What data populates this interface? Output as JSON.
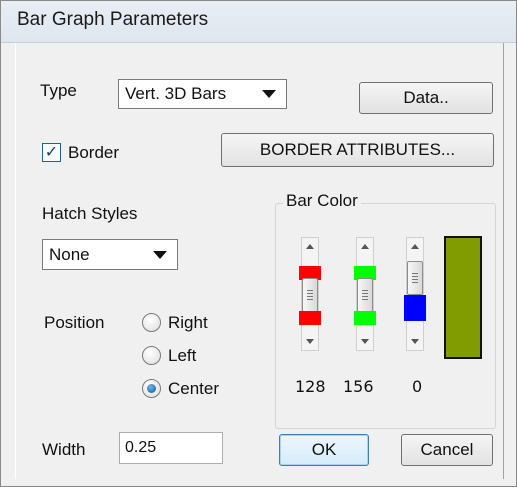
{
  "window": {
    "title": "Bar Graph Parameters"
  },
  "type": {
    "label": "Type",
    "value": "Vert. 3D Bars"
  },
  "data_button": "Data..",
  "border": {
    "label": "Border",
    "checked": true
  },
  "border_attributes_button": "BORDER ATTRIBUTES...",
  "hatch": {
    "label": "Hatch Styles",
    "value": "None"
  },
  "position": {
    "label": "Position",
    "options": [
      "Right",
      "Left",
      "Center"
    ],
    "selected": "Center"
  },
  "bar_color": {
    "label": "Bar Color",
    "red": {
      "value": "128",
      "color": "#ff0000"
    },
    "green": {
      "value": "156",
      "color": "#00ff00"
    },
    "blue": {
      "value": "0",
      "color": "#0000ff"
    },
    "preview_color": "#809c00"
  },
  "width": {
    "label": "Width",
    "value": "0.25"
  },
  "ok_button": "OK",
  "cancel_button": "Cancel"
}
